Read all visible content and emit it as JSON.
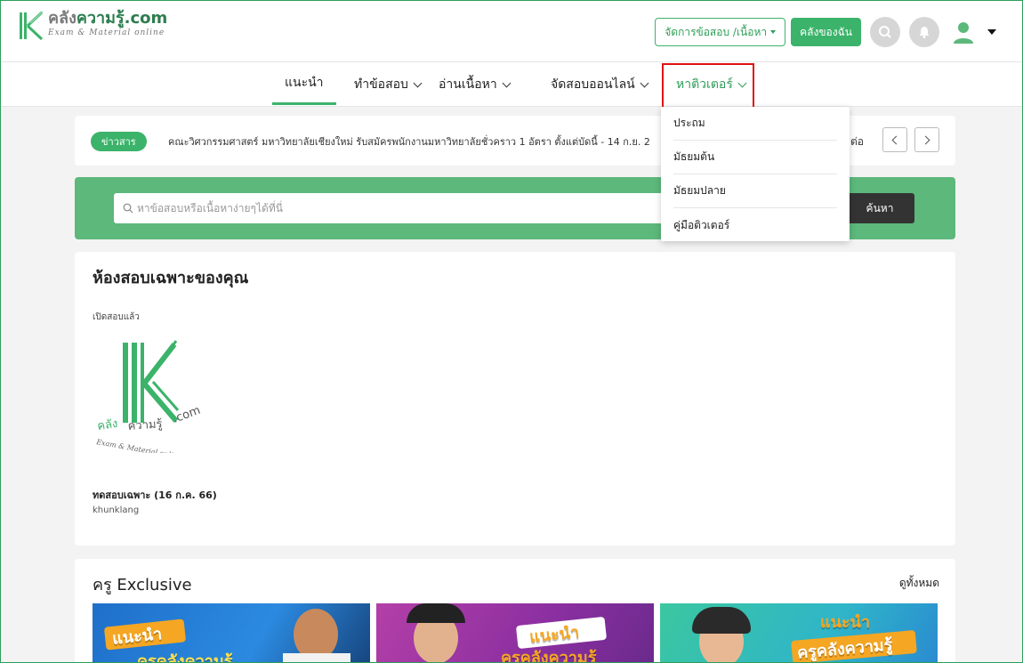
{
  "header": {
    "logo_main_a": "คลัง",
    "logo_main_b": "ความรู้",
    "logo_main_c": ".com",
    "logo_sub": "Exam & Material online",
    "manage_label": "จัดการข้อสอบ /เนื้อหา",
    "my_library_label": "คลังของฉัน"
  },
  "nav": {
    "items": [
      {
        "label": "แนะนำ"
      },
      {
        "label": "ทำข้อสอบ"
      },
      {
        "label": "อ่านเนื้อหา"
      },
      {
        "label": "จัดสอบออนไลน์"
      },
      {
        "label": "หาติวเตอร์"
      }
    ]
  },
  "dropdown": {
    "items": [
      "ประถม",
      "มัธยมต้น",
      "มัธยมปลาย",
      "คู่มือติวเตอร์"
    ]
  },
  "news": {
    "badge": "ข่าวสาร",
    "text": "คณะวิศวกรรมศาสตร์ มหาวิทยาลัยเชียงใหม่ รับสมัครพนักงานมหาวิทยาลัยชั่วคราว 1 อัตรา ตั้งแต่บัดนี้ - 14 ก.ย. 2",
    "more": "ต่อ"
  },
  "search": {
    "placeholder": "หาข้อสอบหรือเนื้อหาง่ายๆได้ที่นี่",
    "button": "ค้นหา"
  },
  "exam_room": {
    "title": "ห้องสอบเฉพาะของคุณ",
    "subtitle": "เปิดสอบแล้ว",
    "exam_name": "ทดสอบเฉพาะ (16 ก.ค. 66)",
    "author": "khunklang"
  },
  "exclusive": {
    "title": "ครู Exclusive",
    "see_all": "ดูทั้งหมด",
    "banners": [
      {
        "line1": "แนะนำ",
        "line2": "ครูคลังความรู้"
      },
      {
        "line1": "แนะนำ",
        "line2": "ครูคลังความรู้"
      },
      {
        "line1": "แนะนำ",
        "line2": "ครูคลังความรู้"
      }
    ]
  },
  "colors": {
    "brand_green": "#3bb36a",
    "highlight_red": "#e01010",
    "search_band": "#5cb87b"
  }
}
